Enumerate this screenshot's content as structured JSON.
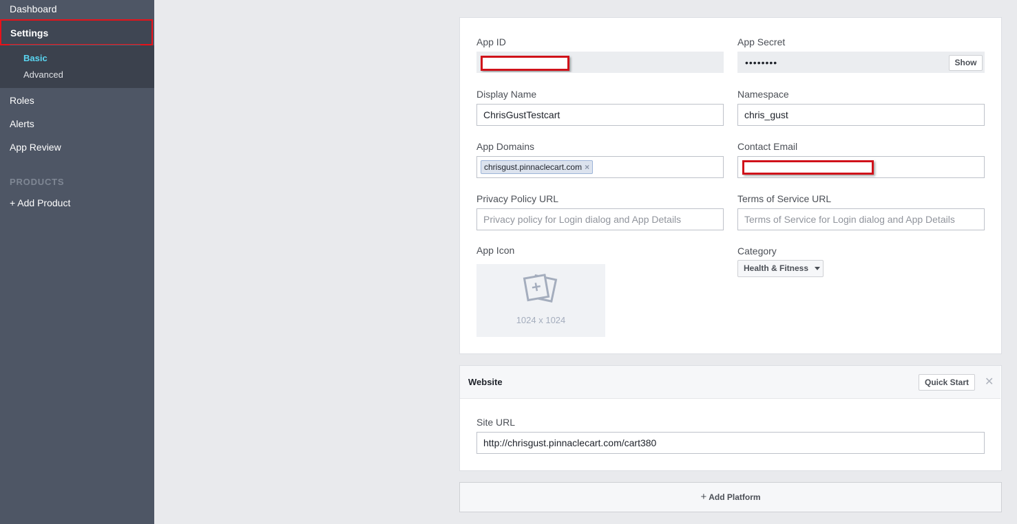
{
  "sidebar": {
    "dashboard": "Dashboard",
    "settings": "Settings",
    "basic": "Basic",
    "advanced": "Advanced",
    "roles": "Roles",
    "alerts": "Alerts",
    "app_review": "App Review",
    "products_heading": "PRODUCTS",
    "add_product": "+ Add Product"
  },
  "basic_settings": {
    "app_id": {
      "label": "App ID",
      "value": ""
    },
    "app_secret": {
      "label": "App Secret",
      "value": "••••••••",
      "show_button": "Show"
    },
    "display_name": {
      "label": "Display Name",
      "value": "ChrisGustTestcart"
    },
    "namespace": {
      "label": "Namespace",
      "value": "chris_gust"
    },
    "app_domains": {
      "label": "App Domains",
      "tokens": [
        "chrisgust.pinnaclecart.com"
      ]
    },
    "contact_email": {
      "label": "Contact Email",
      "value": ""
    },
    "privacy_policy_url": {
      "label": "Privacy Policy URL",
      "placeholder": "Privacy policy for Login dialog and App Details"
    },
    "terms_of_service_url": {
      "label": "Terms of Service URL",
      "placeholder": "Terms of Service for Login dialog and App Details"
    },
    "app_icon": {
      "label": "App Icon",
      "size_hint": "1024 x 1024"
    },
    "category": {
      "label": "Category",
      "value": "Health & Fitness"
    }
  },
  "website": {
    "title": "Website",
    "quick_start_button": "Quick Start",
    "site_url": {
      "label": "Site URL",
      "value": "http://chrisgust.pinnaclecart.com/cart380"
    }
  },
  "add_platform_button": "Add Platform",
  "colors": {
    "sidebar_bg": "#4e5665",
    "page_bg": "#e9eaed",
    "active_subitem": "#5ad6f2",
    "highlight_red": "#e8121a"
  }
}
